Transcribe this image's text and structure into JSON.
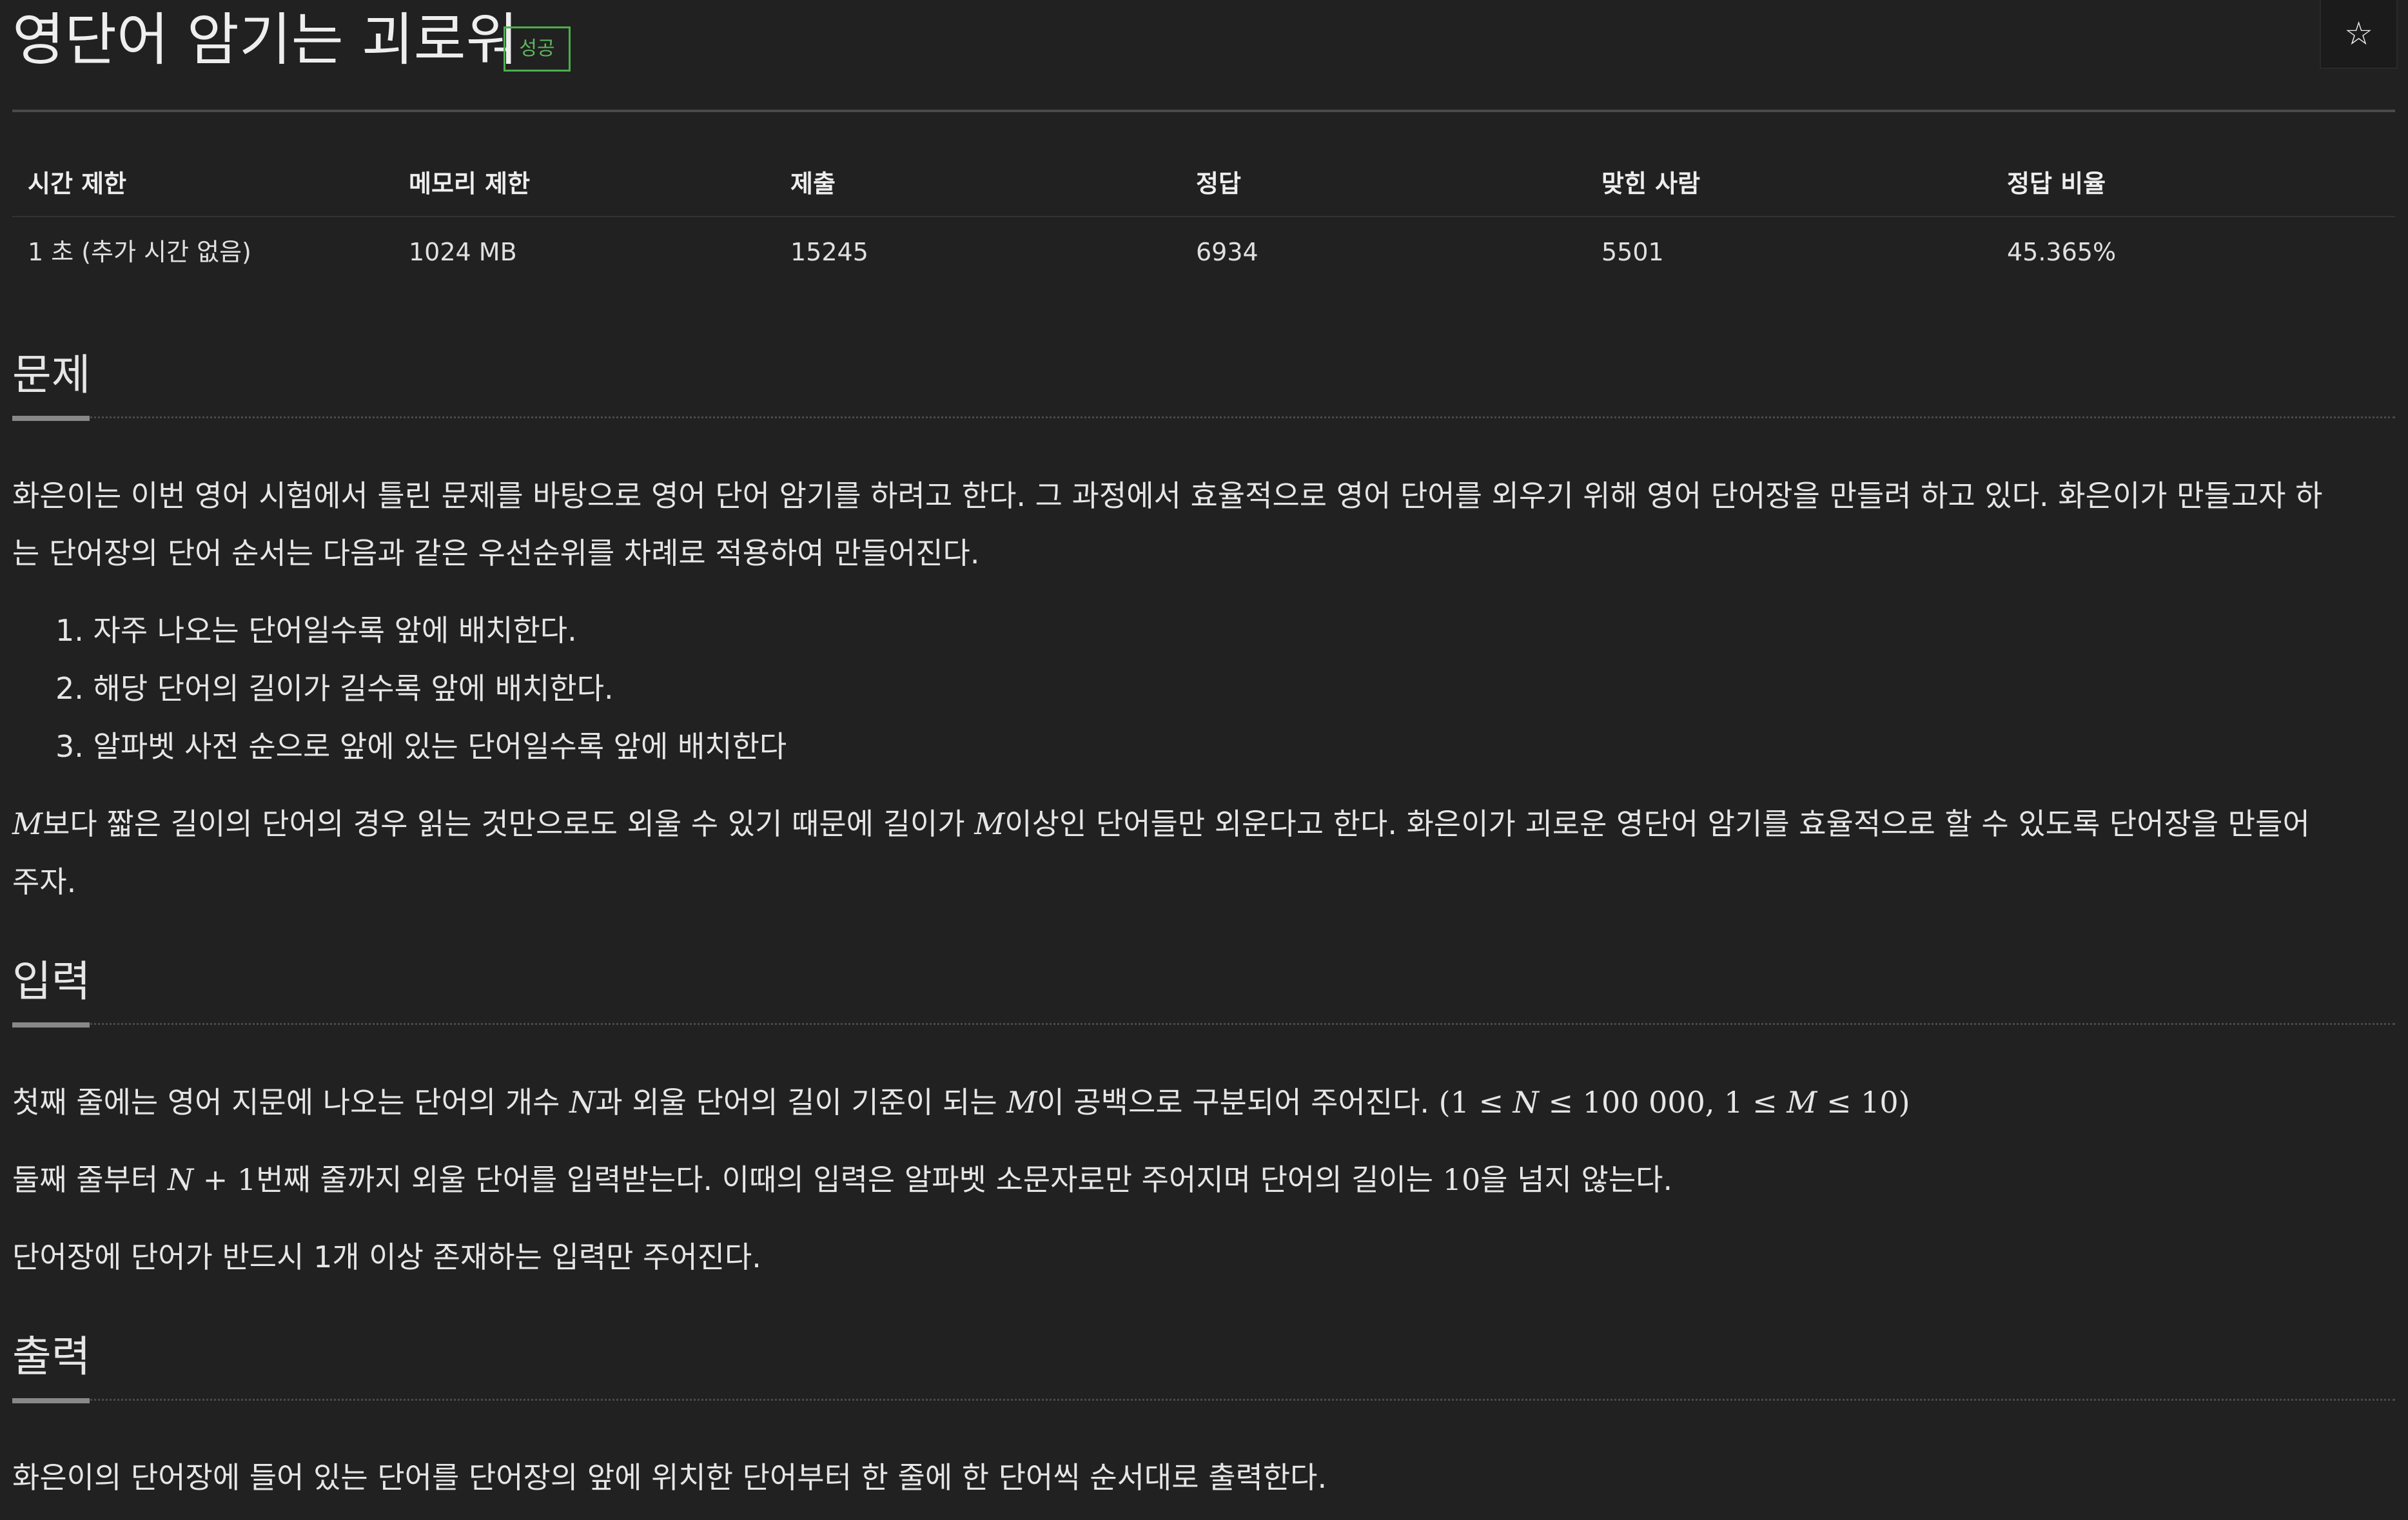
{
  "header": {
    "title": "영단어 암기는 괴로워",
    "badge": "성공",
    "star": "☆"
  },
  "stats": {
    "headers": [
      "시간 제한",
      "메모리 제한",
      "제출",
      "정답",
      "맞힌 사람",
      "정답 비율"
    ],
    "values": [
      "1 초 (추가 시간 없음)",
      "1024 MB",
      "15245",
      "6934",
      "5501",
      "45.365%"
    ]
  },
  "problem": {
    "heading": "문제",
    "p1_line1": "화은이는 이번 영어 시험에서 틀린 문제를 바탕으로 영어 단어 암기를 하려고 한다. 그 과정에서 효율적으로 영어 단어를 외우기 위해 영어 단어장을 만들려 하고 있다. 화은이가 만들고자 하",
    "p1_line2": "는 단어장의 단어 순서는 다음과 같은 우선순위를 차례로 적용하여 만들어진다.",
    "rules": [
      "1. 자주 나오는 단어일수록 앞에 배치한다.",
      "2. 해당 단어의 길이가 길수록 앞에 배치한다.",
      "3. 알파벳 사전 순으로 앞에 있는 단어일수록 앞에 배치한다"
    ],
    "p2_var1": "M",
    "p2_a": "보다 짧은 길이의 단어의 경우 읽는 것만으로도 외울 수 있기 때문에 길이가 ",
    "p2_var2": "M",
    "p2_b": "이상인 단어들만 외운다고 한다. 화은이가 괴로운 영단어 암기를 효율적으로 할 수 있도록 단어장을 만들어",
    "p2_line2": "주자."
  },
  "input": {
    "heading": "입력",
    "l1_a": "첫째 줄에는 영어 지문에 나오는 단어의 개수 ",
    "l1_var1": "N",
    "l1_b": "과 외울 단어의 길이 기준이 되는 ",
    "l1_var2": "M",
    "l1_c": "이 공백으로 구분되어 주어진다. ",
    "l1_range_open": "(1 ≤ ",
    "l1_range_n": "N",
    "l1_range_mid": " ≤ 100 000, 1 ≤ ",
    "l1_range_m": "M",
    "l1_range_close": " ≤ 10)",
    "l2_a": "둘째 줄부터 ",
    "l2_var": "N",
    "l2_plus": " + 1",
    "l2_b": "번째 줄까지 외울 단어를 입력받는다. 이때의 입력은 알파벳 소문자로만 주어지며 단어의 길이는 ",
    "l2_num": "10",
    "l2_c": "을 넘지 않는다.",
    "l3": "단어장에 단어가 반드시 1개 이상 존재하는 입력만 주어진다."
  },
  "output": {
    "heading": "출력",
    "l1": "화은이의 단어장에 들어 있는 단어를 단어장의 앞에 위치한 단어부터 한 줄에 한 단어씩 순서대로 출력한다."
  }
}
